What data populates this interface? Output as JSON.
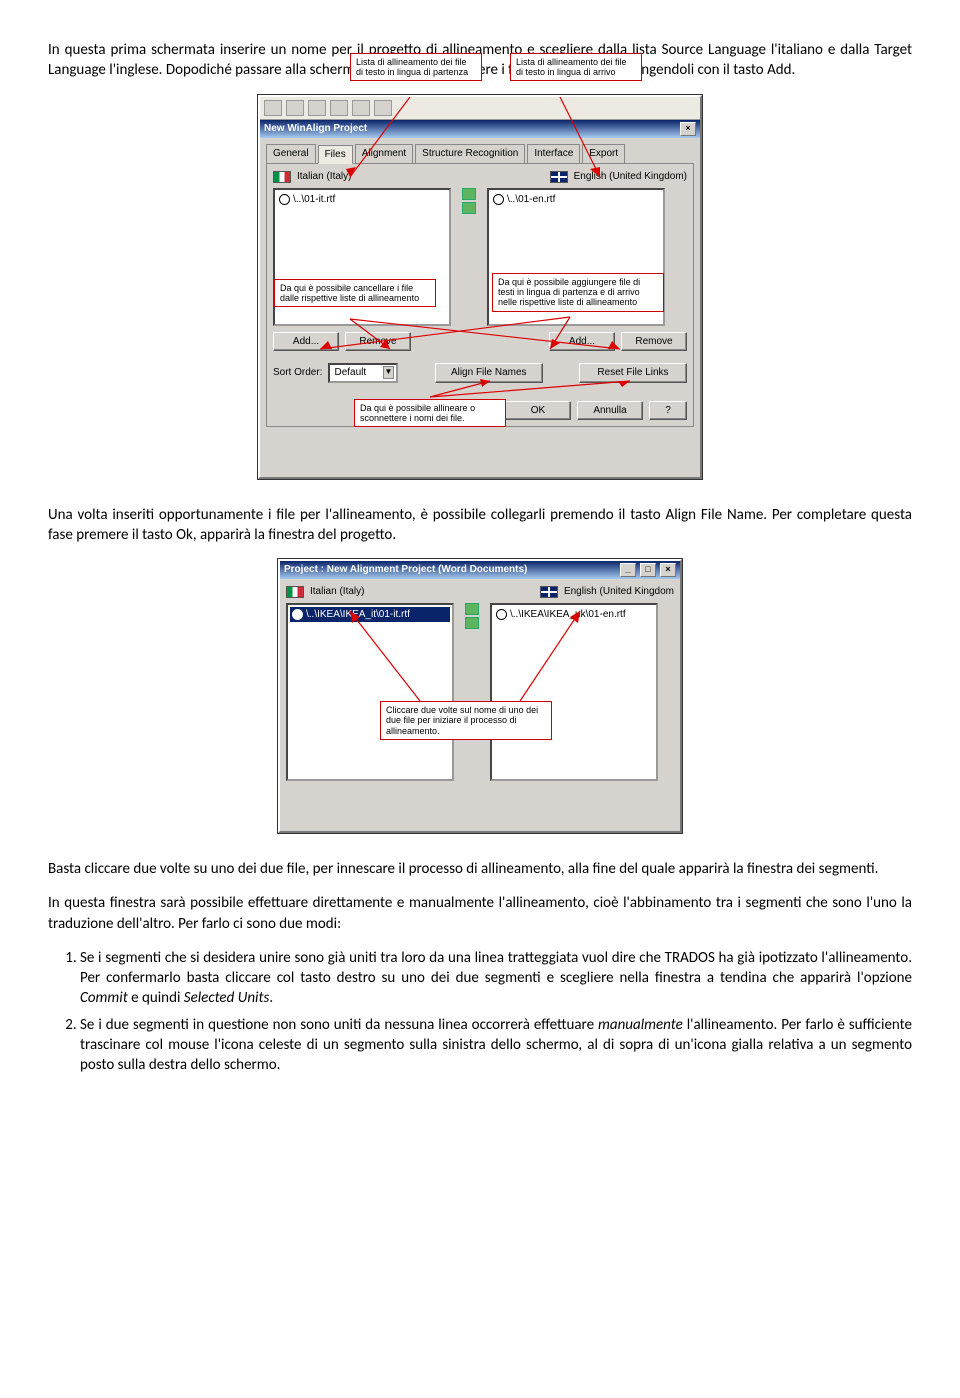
{
  "para1": "In questa prima schermata inserire un nome per il progetto di allineamento e scegliere dalla lista Source Language l'italiano e dalla Target Language l'inglese. Dopodiché passare alla schermata Files, dove scegliere i file da allineare, aggiungendoli con il tasto Add.",
  "para2": "Una volta inseriti opportunamente i file per l'allineamento, è possibile collegarli premendo il tasto Align File Name. Per completare questa fase premere il tasto Ok, apparirà la finestra del progetto.",
  "para3": "Basta cliccare due volte su uno dei due file, per innescare il processo di allineamento, alla fine del quale apparirà la finestra dei segmenti.",
  "para4": "In questa finestra sarà possibile effettuare direttamente e manualmente l'allineamento, cioè l'abbinamento tra i segmenti che sono l'uno la traduzione dell'altro. Per farlo ci sono due modi:",
  "li1a": "Se i segmenti che si desidera unire sono già uniti tra loro da una linea tratteggiata vuol dire che TRADOS ha già ipotizzato l'allineamento. Per confermarlo basta cliccare col tasto destro su uno dei due segmenti e scegliere nella finestra a tendina che apparirà l'opzione ",
  "li1_em1": "Commit",
  "li1b": " e quindi ",
  "li1_em2": "Selected Units",
  "li1c": ".",
  "li2a": "Se i due segmenti in questione non sono uniti da nessuna linea occorrerà effettuare ",
  "li2_em1": "manualmente",
  "li2b": " l'allineamento. Per farlo è sufficiente trascinare col mouse l'icona celeste di un segmento sulla sinistra dello schermo, al di sopra di un'icona gialla relativa a un segmento posto sulla destra dello schermo.",
  "fig1": {
    "title": "New WinAlign Project",
    "tabs": {
      "general": "General",
      "files": "Files",
      "alignment": "Alignment",
      "structure": "Structure Recognition",
      "interface": "Interface",
      "export": "Export"
    },
    "lang_it": "Italian (Italy)",
    "lang_en": "English (United Kingdom)",
    "file_it": "\\..\\01-it.rtf",
    "file_en": "\\..\\01-en.rtf",
    "btn_add": "Add...",
    "btn_remove": "Remove",
    "sort_label": "Sort Order:",
    "sort_val": "Default",
    "btn_align": "Align File Names",
    "btn_reset": "Reset File Links",
    "btn_ok": "OK",
    "btn_cancel": "Annulla",
    "btn_help": "?",
    "callout_top_left": "Lista di allineamento dei file di testo in lingua di partenza",
    "callout_top_right": "Lista di allineamento dei file di testo in lingua di arrivo",
    "callout_mid_left": "Da qui è possibile cancellare i file dalle rispettive liste di allineamento",
    "callout_mid_right": "Da qui è possibile aggiungere file di testi in lingua di partenza e di arrivo nelle rispettive liste di allineamento",
    "callout_bottom": "Da qui è possibile allineare o sconnettere i nomi dei file."
  },
  "fig2": {
    "title": "Project : New Alignment Project (Word Documents)",
    "lang_it": "Italian (Italy)",
    "lang_en": "English (United Kingdom",
    "file_it": "\\..\\IKEA\\IKEA_it\\01-it.rtf",
    "file_en": "\\..\\IKEA\\IKEA_uk\\01-en.rtf",
    "callout": "Cliccare due volte sul nome di uno dei due file per iniziare il processo di allineamento."
  }
}
